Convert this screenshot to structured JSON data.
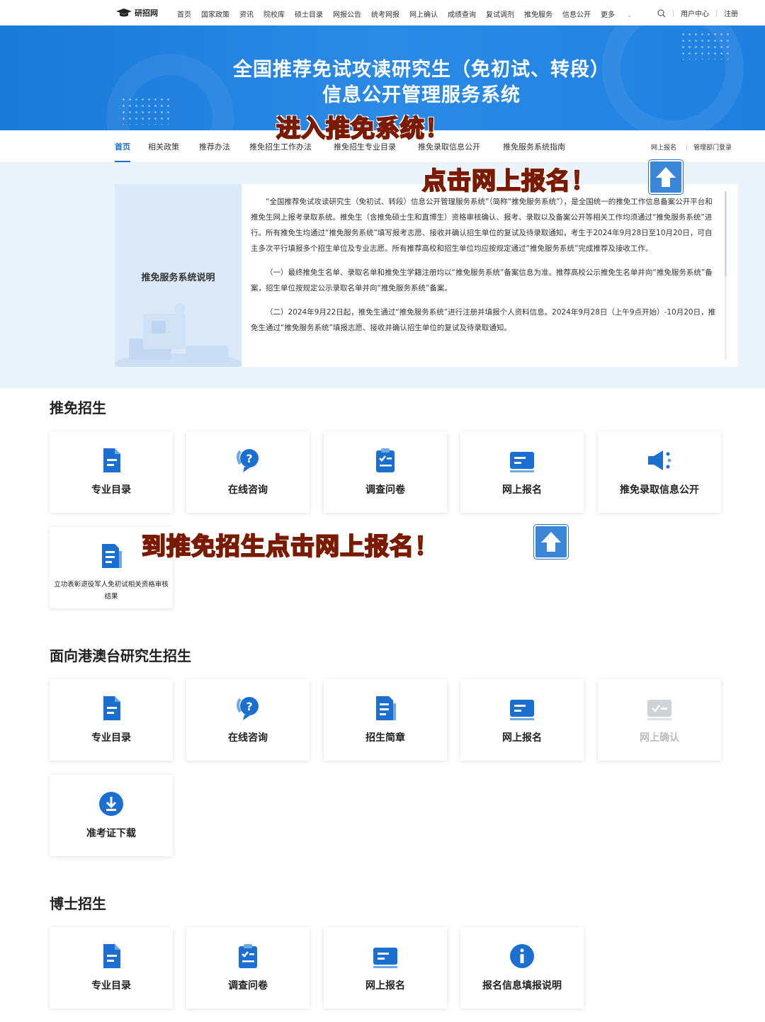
{
  "topnav": {
    "logo": "研招网",
    "links": [
      "首页",
      "国家政策",
      "资讯",
      "院校库",
      "硕士目录",
      "网报公告",
      "统考网报",
      "网上确认",
      "成绩查询",
      "复试调剂",
      "推免服务",
      "信息公开",
      "更多"
    ],
    "user_center": "用户中心",
    "register": "注册"
  },
  "banner": {
    "title_line1": "全国推荐免试攻读研究生（免初试、转段）",
    "title_line2": "信息公开管理服务系统"
  },
  "subnav": {
    "items": [
      "首页",
      "相关政策",
      "推荐办法",
      "推免招生工作办法",
      "推免招生专业目录",
      "推免录取信息公开",
      "推免服务系统指南"
    ],
    "right_links": [
      "网上报名",
      "管理部门登录"
    ]
  },
  "info": {
    "side_title": "推免服务系统说明",
    "paragraphs": [
      "“全国推荐免试攻读研究生（免初试、转段）信息公开管理服务系统”（简称“推免服务系统”），是全国统一的推免工作信息备案公开平台和推免生网上报考录取系统。推免生（含推免硕士生和直博生）资格审核确认、报考、录取以及备案公开等相关工作均须通过“推免服务系统”进行。所有推免生均通过“推免服务系统”填写报考志愿、接收并确认招生单位的复试及待录取通知，考生于2024年9月28日至10月20日，可自主多次平行填报多个招生单位及专业志愿。所有推荐高校和招生单位均应按规定通过“推免服务系统”完成推荐及接收工作。",
      "（一）最终推免生名单、录取名单和推免生学籍注册均以“推免服务系统”备案信息为准。推荐高校公示推免生名单并向“推免服务系统”备案，招生单位按规定公示录取名单并向“推免服务系统”备案。",
      "（二）2024年9月22日起，推免生通过“推免服务系统”进行注册并填报个人资料信息。2024年9月28日（上午9点开始）-10月20日，推免生通过“推免服务系统”填报志愿、接收并确认招生单位的复试及待录取通知。"
    ]
  },
  "sections": [
    {
      "title": "推免招生",
      "cards": [
        {
          "label": "专业目录",
          "icon": "document-icon"
        },
        {
          "label": "在线咨询",
          "icon": "question-bubble-icon"
        },
        {
          "label": "调查问卷",
          "icon": "clipboard-icon"
        },
        {
          "label": "网上报名",
          "icon": "form-icon"
        },
        {
          "label": "推免录取信息公开",
          "icon": "megaphone-icon"
        },
        {
          "label": "立功表彰退役军人免初试相关资格审核结果",
          "icon": "document-lines-icon"
        }
      ]
    },
    {
      "title": "面向港澳台研究生招生",
      "cards": [
        {
          "label": "专业目录",
          "icon": "document-icon"
        },
        {
          "label": "在线咨询",
          "icon": "question-bubble-icon"
        },
        {
          "label": "招生简章",
          "icon": "document-lines-icon"
        },
        {
          "label": "网上报名",
          "icon": "form-icon"
        },
        {
          "label": "网上确认",
          "icon": "confirm-icon",
          "disabled": true
        },
        {
          "label": "准考证下载",
          "icon": "download-icon"
        }
      ]
    },
    {
      "title": "博士招生",
      "cards": [
        {
          "label": "专业目录",
          "icon": "document-icon"
        },
        {
          "label": "调查问卷",
          "icon": "clipboard-icon"
        },
        {
          "label": "网上报名",
          "icon": "form-icon"
        },
        {
          "label": "报名信息填报说明",
          "icon": "info-icon"
        }
      ]
    }
  ],
  "stickers": {
    "s1": "进入推免系统！",
    "s2": "点击网上报名！",
    "s3": "到推免招生点击网上报名！"
  },
  "colors": {
    "brand_blue": "#1a6fd0",
    "banner_blue": "#2b8ae6",
    "sticker_orange": "#ff7a1a"
  }
}
